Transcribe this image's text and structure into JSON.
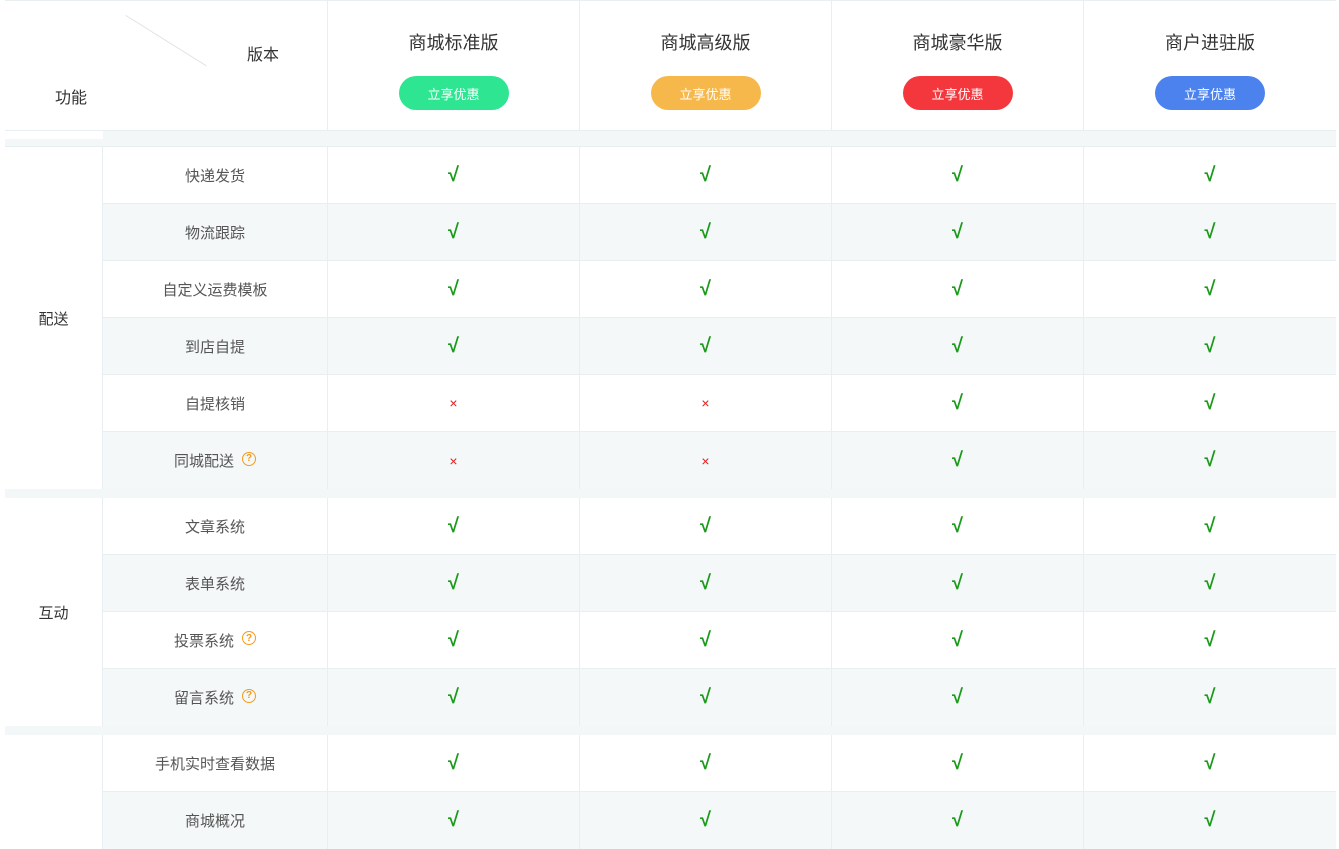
{
  "header": {
    "version_label": "版本",
    "feature_label": "功能",
    "versions": [
      {
        "name": "商城标准版",
        "button": "立享优惠",
        "color": "#2ee592"
      },
      {
        "name": "商城高级版",
        "button": "立享优惠",
        "color": "#f7b84b"
      },
      {
        "name": "商城豪华版",
        "button": "立享优惠",
        "color": "#f4373c"
      },
      {
        "name": "商户进驻版",
        "button": "立享优惠",
        "color": "#4b82ee"
      }
    ]
  },
  "symbols": {
    "yes": "√",
    "no": "×",
    "help": "?"
  },
  "sections": [
    {
      "category": "配送",
      "rows": [
        {
          "feature": "快递发货",
          "help": false,
          "values": [
            true,
            true,
            true,
            true
          ]
        },
        {
          "feature": "物流跟踪",
          "help": false,
          "values": [
            true,
            true,
            true,
            true
          ]
        },
        {
          "feature": "自定义运费模板",
          "help": false,
          "values": [
            true,
            true,
            true,
            true
          ]
        },
        {
          "feature": "到店自提",
          "help": false,
          "values": [
            true,
            true,
            true,
            true
          ]
        },
        {
          "feature": "自提核销",
          "help": false,
          "values": [
            false,
            false,
            true,
            true
          ]
        },
        {
          "feature": "同城配送",
          "help": true,
          "values": [
            false,
            false,
            true,
            true
          ]
        }
      ]
    },
    {
      "category": "互动",
      "rows": [
        {
          "feature": "文章系统",
          "help": false,
          "values": [
            true,
            true,
            true,
            true
          ]
        },
        {
          "feature": "表单系统",
          "help": false,
          "values": [
            true,
            true,
            true,
            true
          ]
        },
        {
          "feature": "投票系统",
          "help": true,
          "values": [
            true,
            true,
            true,
            true
          ]
        },
        {
          "feature": "留言系统",
          "help": true,
          "values": [
            true,
            true,
            true,
            true
          ]
        }
      ]
    },
    {
      "category": "",
      "rows": [
        {
          "feature": "手机实时查看数据",
          "help": false,
          "values": [
            true,
            true,
            true,
            true
          ]
        },
        {
          "feature": "商城概况",
          "help": false,
          "values": [
            true,
            true,
            true,
            true
          ]
        }
      ]
    }
  ]
}
